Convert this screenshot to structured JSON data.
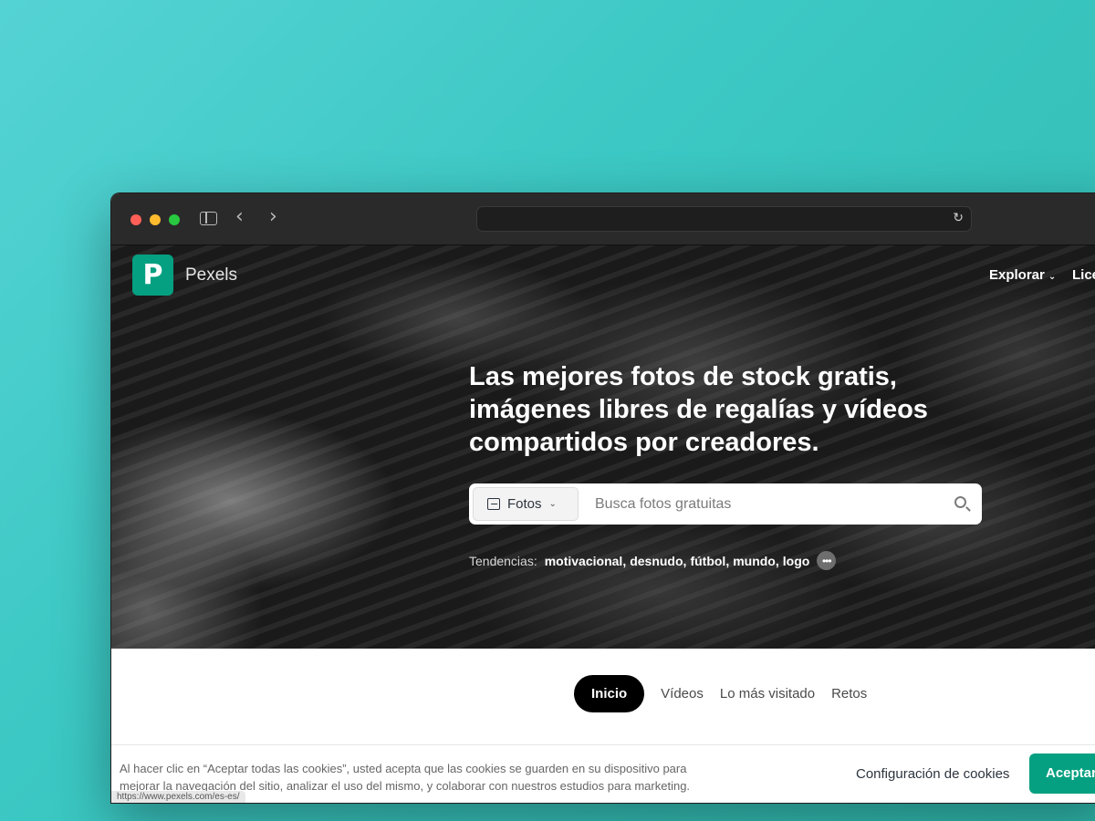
{
  "browser": {
    "url": "",
    "status_url": "https://www.pexels.com/es-es/"
  },
  "header": {
    "brand": "Pexels",
    "logo_letter": "P",
    "nav_explore": "Explorar",
    "nav_license": "Lice"
  },
  "hero": {
    "headline": "Las mejores fotos de stock gratis, imágenes libres de regalías y vídeos compartidos por creadores.",
    "search": {
      "type_label": "Fotos",
      "placeholder": "Busca fotos gratuitas"
    },
    "trending": {
      "label": "Tendencias:",
      "tags": [
        "motivacional",
        "desnudo",
        "fútbol",
        "mundo",
        "logo"
      ],
      "more": "•••"
    }
  },
  "tabs": [
    {
      "label": "Inicio",
      "active": true
    },
    {
      "label": "Vídeos",
      "active": false
    },
    {
      "label": "Lo más visitado",
      "active": false
    },
    {
      "label": "Retos",
      "active": false
    }
  ],
  "cookies": {
    "text": "Al hacer clic en “Aceptar todas las cookies”, usted acepta que las cookies se guarden en su dispositivo para mejorar la navegación del sitio, analizar el uso del mismo, y colaborar con nuestros estudios para marketing.",
    "config_label": "Configuración de cookies",
    "accept_label": "Aceptar"
  },
  "colors": {
    "brand_green": "#05a081",
    "background_teal": "#3cc8c4"
  }
}
